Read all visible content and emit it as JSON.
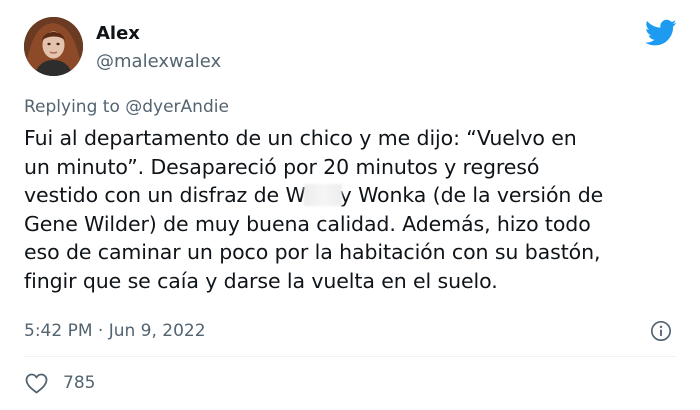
{
  "author": {
    "name": "Alex",
    "handle": "@malexwalex",
    "avatar_icon": "profile-photo"
  },
  "brand": {
    "icon": "twitter-bird-icon",
    "color": "#1d9bf0"
  },
  "reply": {
    "prefix": "Replying to ",
    "mention": "@dyerAndie"
  },
  "tweet": {
    "line1": "Fui al departamento de un chico y me dijo: “Vuelvo en",
    "line2": "un minuto”. Desapareció por 20 minutos y regresó",
    "line3_before": "vestido con un disfraz de W",
    "line3_after": "y Wonka (de la versión de",
    "line4": "Gene Wilder) de muy buena calidad. Además, hizo todo",
    "line5": "eso de caminar un poco por la habitación con su bastón,",
    "line6": "fingir que se caía y darse la vuelta en el suelo."
  },
  "meta": {
    "timestamp": "5:42 PM · Jun 9, 2022",
    "info_icon": "info-icon"
  },
  "engagement": {
    "like_icon": "heart-icon",
    "likes": "785"
  }
}
